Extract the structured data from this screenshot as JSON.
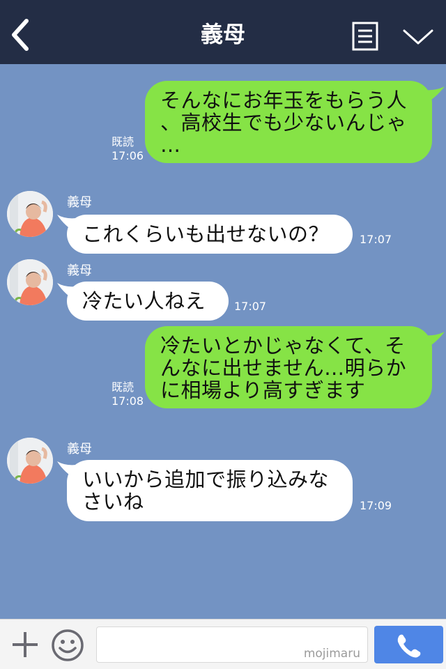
{
  "header": {
    "title": "義母",
    "back_icon": "chevron-left-icon",
    "menu_icon": "list-icon",
    "dropdown_icon": "chevron-down-icon"
  },
  "messages": [
    {
      "direction": "outgoing",
      "text": "そんなにお年玉をもらう人\n、高校生でも少ないんじゃ\n…",
      "read": "既読",
      "time": "17:06"
    },
    {
      "direction": "incoming",
      "sender": "義母",
      "text": "これくらいも出せないの？",
      "time": "17:07"
    },
    {
      "direction": "incoming",
      "sender": "義母",
      "text": "冷たい人ねえ",
      "time": "17:07"
    },
    {
      "direction": "outgoing",
      "text": "冷たいとかじゃなくて、そ\nんなに出せません…明らか\nに相場より高すぎます",
      "read": "既読",
      "time": "17:08"
    },
    {
      "direction": "incoming",
      "sender": "義母",
      "text": "いいから追加で振り込みな\nさいね",
      "time": "17:09"
    }
  ],
  "footer": {
    "plus_icon": "plus-icon",
    "emoji_icon": "smiley-icon",
    "input_value": "",
    "watermark": "mojimaru",
    "call_icon": "phone-icon"
  },
  "colors": {
    "header_bg": "#232d45",
    "chat_bg": "#7393c3",
    "outgoing_bubble": "#86e346",
    "incoming_bubble": "#ffffff",
    "call_button": "#4f86e6"
  }
}
